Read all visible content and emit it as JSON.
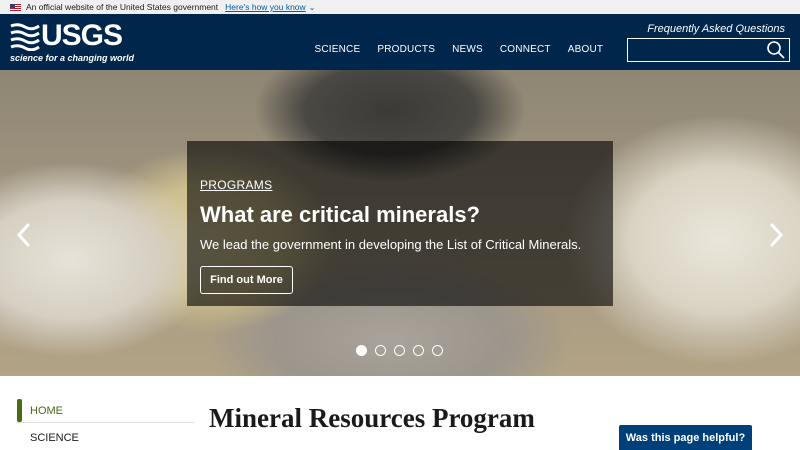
{
  "gov_banner": {
    "text": "An official website of the United States government",
    "link": "Here's how you know",
    "chevron_icon": "chevron-down-icon"
  },
  "header": {
    "logo_text": "USGS",
    "logo_tagline": "science for a changing world",
    "faq_link": "Frequently Asked Questions",
    "nav": [
      "SCIENCE",
      "PRODUCTS",
      "NEWS",
      "CONNECT",
      "ABOUT"
    ],
    "search_icon": "search-icon",
    "colors": {
      "header_bg": "#00264c",
      "text": "#ffffff"
    }
  },
  "hero": {
    "kicker": "PROGRAMS",
    "title": "What are critical minerals?",
    "subtitle": "We lead the government in developing the List of Critical Minerals.",
    "button": "Find out More",
    "slide_count": 5,
    "active_slide": 1,
    "prev_icon": "chevron-left-icon",
    "next_icon": "chevron-right-icon"
  },
  "sidebar": {
    "items": [
      "HOME",
      "SCIENCE"
    ],
    "active_color": "#4a6a15"
  },
  "main": {
    "title": "Mineral Resources Program"
  },
  "feedback": {
    "button": "Was this page helpful?",
    "color": "#00407a"
  }
}
